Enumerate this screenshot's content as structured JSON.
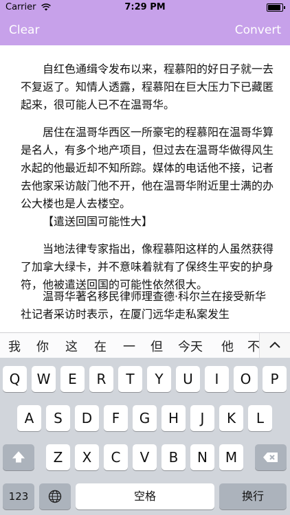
{
  "status_bar": {
    "carrier": "Carrier",
    "time": "7:29 PM",
    "wifi_icon": "wifi-icon",
    "battery_icon": "battery-icon"
  },
  "nav": {
    "left_button": "Clear",
    "right_button": "Convert",
    "bar_color": "#c7a1ea"
  },
  "article": {
    "paragraphs": [
      "自红色通缉令发布以来，程慕阳的好日子就一去不复返了。知情人透露，程慕阳在巨大压力下已藏匿起来，很可能人已不在温哥华。",
      "居住在温哥华西区一所豪宅的程慕阳在温哥华算是名人，有多个地产项目，但过去在温哥华做得风生水起的他最近却不知所踪。媒体的电话他不接，记者去他家采访敲门他不开，他在温哥华附近里士满的办公大楼也是人去楼空。",
      "【遣送回国可能性大】",
      "当地法律专家指出，像程慕阳这样的人虽然获得了加拿大绿卡，并不意味着就有了保终生平安的护身符，他被遣送回国的可能性依然很大。",
      "温哥华著名移民律师理查德·科尔兰在接受新华社记者采访时表示，在厦门远华走私案发生"
    ]
  },
  "candidates": [
    "我",
    "你",
    "这",
    "在",
    "一",
    "但",
    "今天",
    "他",
    "不"
  ],
  "collapse_icon": "chevron-up-icon",
  "keyboard": {
    "row1": [
      "Q",
      "W",
      "E",
      "R",
      "T",
      "Y",
      "U",
      "I",
      "O",
      "P"
    ],
    "row2": [
      "A",
      "S",
      "D",
      "F",
      "G",
      "H",
      "J",
      "K",
      "L"
    ],
    "row3": [
      "Z",
      "X",
      "C",
      "V",
      "B",
      "N",
      "M"
    ],
    "shift_icon": "shift-icon",
    "delete_icon": "delete-icon",
    "numbers_key": "123",
    "globe_icon": "globe-icon",
    "space_key": "空格",
    "return_key": "换行"
  }
}
